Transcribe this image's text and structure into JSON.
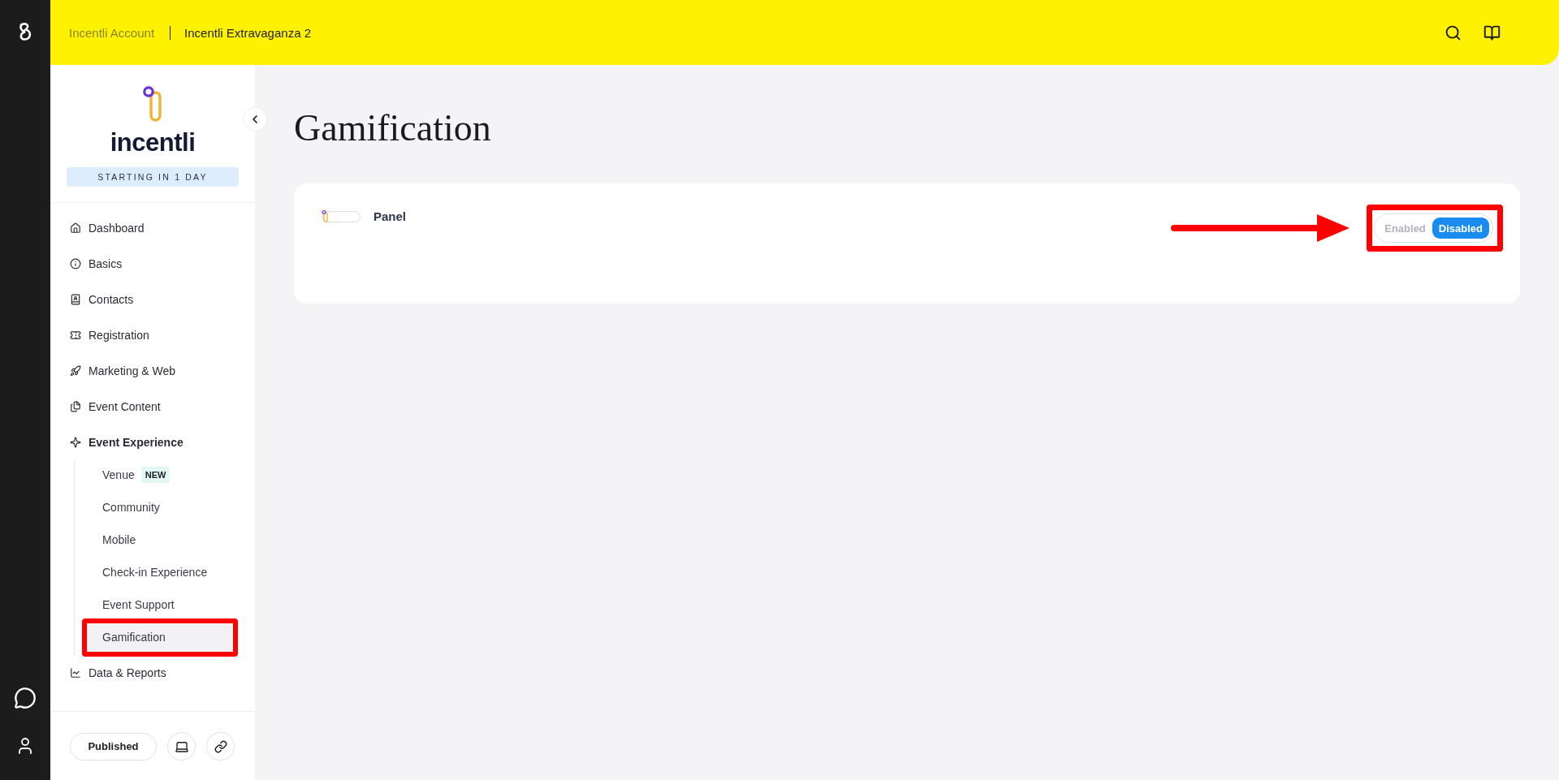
{
  "topbar": {
    "breadcrumbs": [
      {
        "label": "Incentli Account",
        "selected": false
      },
      {
        "label": "Incentli Extravaganza 2",
        "selected": true
      }
    ]
  },
  "sidebar": {
    "brand": "incentli",
    "status": "STARTING IN 1 DAY",
    "items": [
      {
        "label": "Dashboard",
        "expanded": false
      },
      {
        "label": "Basics",
        "expanded": false
      },
      {
        "label": "Contacts",
        "expanded": false
      },
      {
        "label": "Registration",
        "expanded": false
      },
      {
        "label": "Marketing & Web",
        "expanded": false
      },
      {
        "label": "Event Content",
        "expanded": false
      },
      {
        "label": "Event Experience",
        "expanded": true,
        "children": [
          {
            "label": "Venue",
            "badge": "NEW",
            "selected": false,
            "highlighted": false
          },
          {
            "label": "Community",
            "selected": false,
            "highlighted": false
          },
          {
            "label": "Mobile",
            "selected": false,
            "highlighted": false
          },
          {
            "label": "Check-in Experience",
            "selected": false,
            "highlighted": false
          },
          {
            "label": "Event Support",
            "selected": false,
            "highlighted": false
          },
          {
            "label": "Gamification",
            "selected": true,
            "highlighted": true
          }
        ]
      },
      {
        "label": "Data & Reports",
        "expanded": false
      }
    ],
    "footer": {
      "status_button": "Published"
    }
  },
  "page": {
    "title": "Gamification"
  },
  "card": {
    "title": "Panel",
    "toggle": {
      "highlighted": true,
      "options": [
        {
          "label": "Enabled",
          "selected": false
        },
        {
          "label": "Disabled",
          "selected": true
        }
      ]
    }
  }
}
